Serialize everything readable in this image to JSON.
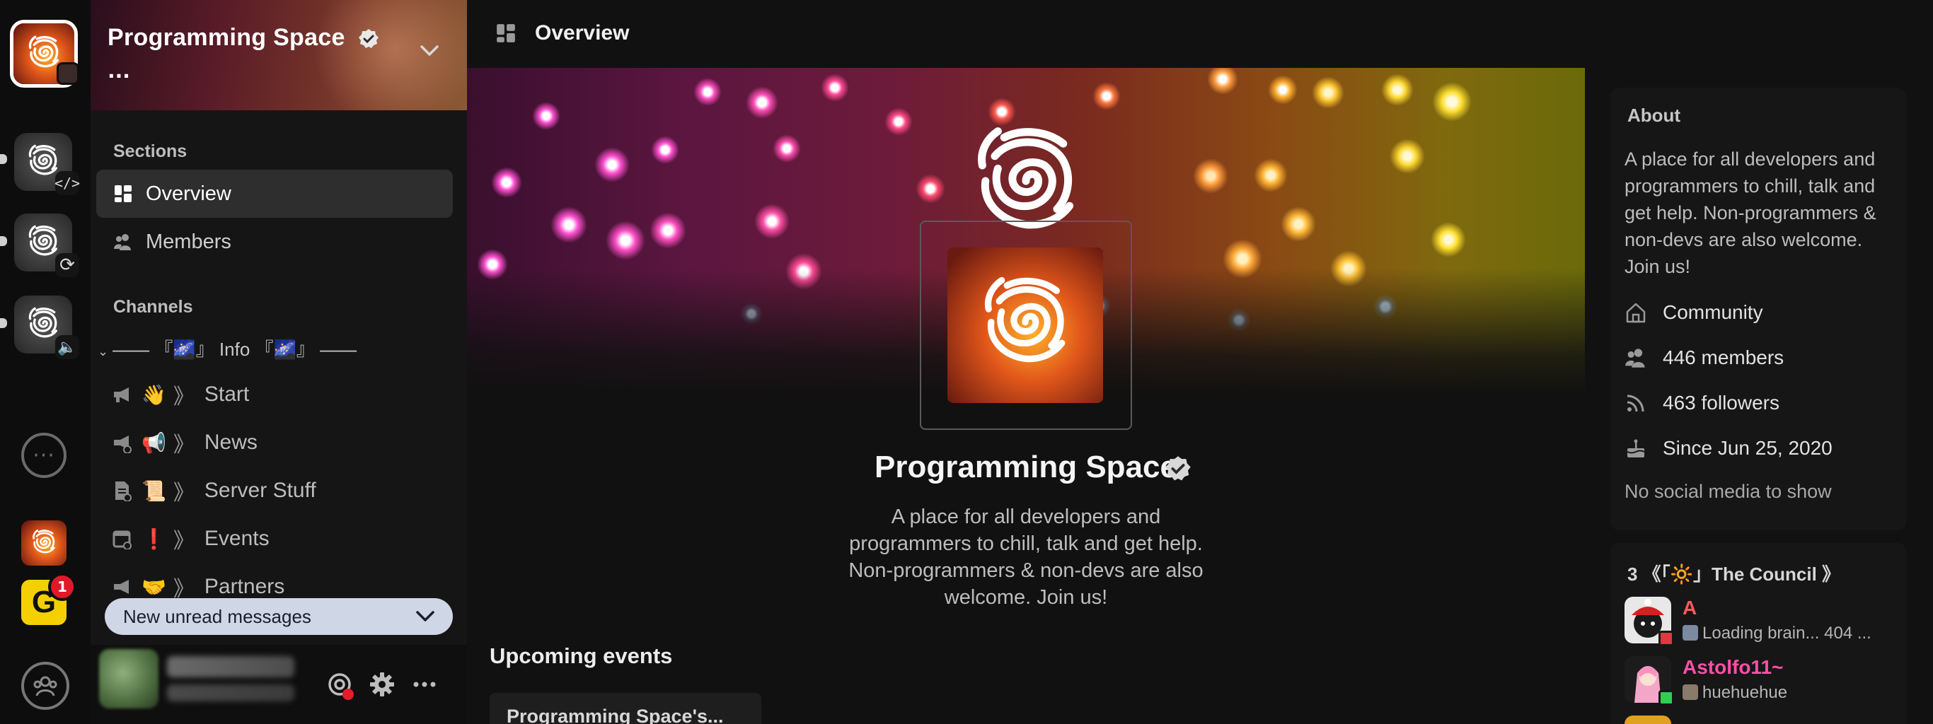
{
  "colors": {
    "background": "#111111",
    "sidebar": "#151515",
    "accent_active": "#2e2e2e",
    "unread_pill": "#cfd6e6",
    "notification_red": "#e0192a",
    "online_green": "#2fcf4f",
    "dnd_red": "#e0393f",
    "member_a_color": "#ff5a5a",
    "member_astolfo_color": "#ff4fa8"
  },
  "server_rail": {
    "servers": [
      {
        "name": "Programming Space",
        "icon": "spiral-logo",
        "active": true
      },
      {
        "name": "Programming Space (code)",
        "icon": "spiral-logo",
        "badge_icon": "code-icon"
      },
      {
        "name": "Programming Space (sync)",
        "icon": "spiral-logo",
        "badge_icon": "sync-icon"
      },
      {
        "name": "Programming Space (voice)",
        "icon": "spiral-logo",
        "badge_icon": "speaker-icon"
      }
    ],
    "chat_icon": "chat-bubble-icon",
    "g_server_letter": "G",
    "g_server_badge": "1",
    "home_icon": "community-home-icon"
  },
  "server_header": {
    "title": "Programming Space",
    "subtitle": "...",
    "verified_icon": "verified-check-icon",
    "menu_icon": "chevron-down-icon"
  },
  "sidebar": {
    "sections_label": "Sections",
    "sections": [
      {
        "label": "Overview",
        "icon": "grid-icon",
        "active": true
      },
      {
        "label": "Members",
        "icon": "members-icon",
        "active": false
      }
    ],
    "channels_label": "Channels",
    "category": {
      "label": "—— 『🌌』 Info 『🌌』 ——",
      "collapse_icon": "chevron-down-small-icon"
    },
    "channels": [
      {
        "icon": "megaphone-icon",
        "emoji": "👋",
        "sep": "》",
        "label": "Start"
      },
      {
        "icon": "megaphone-icon",
        "emoji": "📢",
        "sep": "》",
        "label": "News"
      },
      {
        "icon": "document-icon",
        "emoji": "📜",
        "sep": "》",
        "label": "Server Stuff"
      },
      {
        "icon": "calendar-icon",
        "emoji": "❗",
        "sep": "》",
        "label": "Events"
      },
      {
        "icon": "megaphone-icon",
        "emoji": "🤝",
        "sep": "》",
        "label": "Partners"
      }
    ],
    "unread_banner": "New unread messages"
  },
  "user_bar": {
    "buttons": [
      "mention-record-icon",
      "settings-gear-icon",
      "more-dots-icon"
    ]
  },
  "topbar": {
    "icon": "grid-icon",
    "title": "Overview"
  },
  "overview": {
    "name": "Programming Space",
    "description": "A place for all developers and programmers to chill, talk and get help. Non-programmers & non-devs are also welcome. Join us!",
    "events_title": "Upcoming events",
    "event_card_title": "Programming Space's..."
  },
  "about": {
    "title": "About",
    "description": "A place for all developers and programmers to chill, talk and get help. Non-programmers & non-devs are also welcome. Join us!",
    "rows": [
      {
        "icon": "house-icon",
        "text": "Community"
      },
      {
        "icon": "members-icon",
        "text": "446 members"
      },
      {
        "icon": "rss-icon",
        "text": "463 followers"
      },
      {
        "icon": "cake-icon",
        "text": "Since Jun 25, 2020"
      }
    ],
    "no_social": "No social media to show"
  },
  "council": {
    "title": "3 《「🔆」The Council 》",
    "members": [
      {
        "name": "A",
        "status": "Loading brain... 404 ...",
        "presence": "dnd"
      },
      {
        "name": "Astolfo11~",
        "status": "huehuehue",
        "presence": "online"
      }
    ]
  }
}
